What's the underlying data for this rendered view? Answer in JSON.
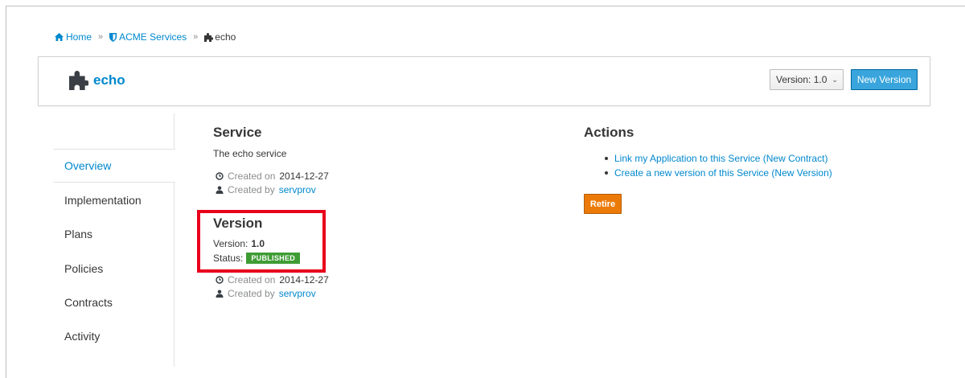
{
  "breadcrumb": {
    "home": "Home",
    "org": "ACME Services",
    "current": "echo",
    "separator": "»"
  },
  "header": {
    "title": "echo",
    "version_dropdown": "Version: 1.0",
    "new_version_button": "New Version"
  },
  "sidebar": {
    "items": [
      {
        "label": "Overview",
        "active": true
      },
      {
        "label": "Implementation",
        "active": false
      },
      {
        "label": "Plans",
        "active": false
      },
      {
        "label": "Policies",
        "active": false
      },
      {
        "label": "Contracts",
        "active": false
      },
      {
        "label": "Activity",
        "active": false
      }
    ]
  },
  "service": {
    "heading": "Service",
    "description": "The echo service",
    "created_on_label": "Created on",
    "created_on": "2014-12-27",
    "created_by_label": "Created by",
    "created_by": "servprov"
  },
  "version": {
    "heading": "Version",
    "version_label": "Version:",
    "version_value": "1.0",
    "status_label": "Status:",
    "status_value": "PUBLISHED",
    "created_on_label": "Created on",
    "created_on": "2014-12-27",
    "created_by_label": "Created by",
    "created_by": "servprov"
  },
  "actions": {
    "heading": "Actions",
    "links": [
      "Link my Application to this Service (New Contract)",
      "Create a new version of this Service (New Version)"
    ],
    "retire_button": "Retire"
  },
  "colors": {
    "link": "#0088ce",
    "primary_button": "#39a5dc",
    "retire_button": "#ec7a08",
    "published_badge": "#3f9c35",
    "highlight": "#e8001b"
  },
  "icons": {
    "home": "home-icon",
    "org": "shield-icon",
    "service": "puzzle-icon",
    "clock": "clock-icon",
    "user": "user-icon",
    "caret": "chevron-down-icon"
  }
}
